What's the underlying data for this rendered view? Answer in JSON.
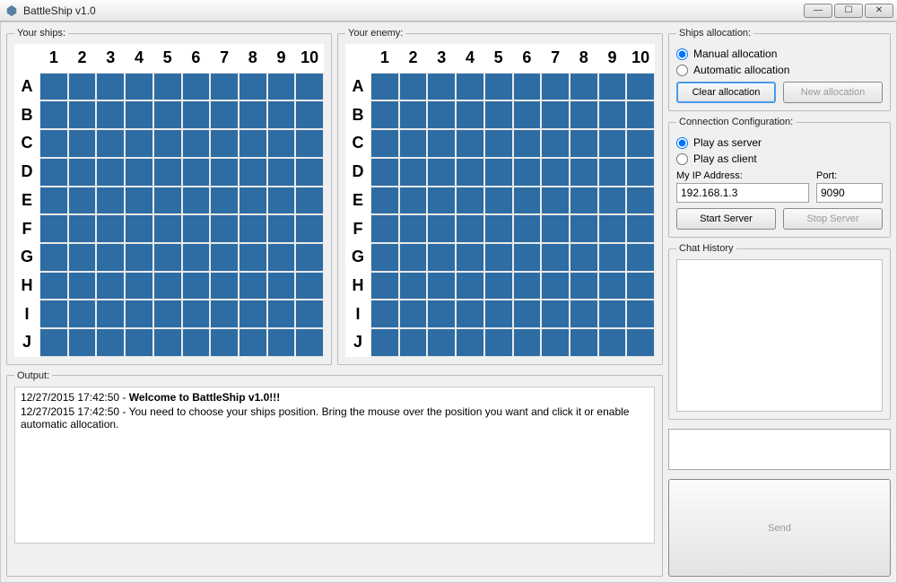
{
  "title": "BattleShip v1.0",
  "board": {
    "your_ships_label": "Your ships:",
    "your_enemy_label": "Your enemy:",
    "columns": [
      "1",
      "2",
      "3",
      "4",
      "5",
      "6",
      "7",
      "8",
      "9",
      "10"
    ],
    "rows": [
      "A",
      "B",
      "C",
      "D",
      "E",
      "F",
      "G",
      "H",
      "I",
      "J"
    ]
  },
  "output": {
    "legend": "Output:",
    "lines": [
      {
        "timestamp": "12/27/2015 17:42:50",
        "bold": true,
        "text": "Welcome to BattleShip v1.0!!!"
      },
      {
        "timestamp": "12/27/2015 17:42:50",
        "bold": false,
        "text": "You need to choose your ships position. Bring the mouse over the position you want and click it or enable automatic allocation."
      }
    ]
  },
  "ships_allocation": {
    "legend": "Ships allocation:",
    "manual_label": "Manual allocation",
    "automatic_label": "Automatic allocation",
    "selected": "manual",
    "clear_label": "Clear allocation",
    "new_label": "New allocation",
    "new_enabled": false
  },
  "connection": {
    "legend": "Connection Configuration:",
    "server_label": "Play as server",
    "client_label": "Play as client",
    "selected": "server",
    "ip_label": "My IP Address:",
    "port_label": "Port:",
    "ip_value": "192.168.1.3",
    "port_value": "9090",
    "start_label": "Start Server",
    "stop_label": "Stop Server",
    "stop_enabled": false
  },
  "chat": {
    "legend": "Chat History",
    "send_label": "Send",
    "send_enabled": false
  },
  "window_controls": {
    "min": "—",
    "max": "☐",
    "close": "✕"
  }
}
